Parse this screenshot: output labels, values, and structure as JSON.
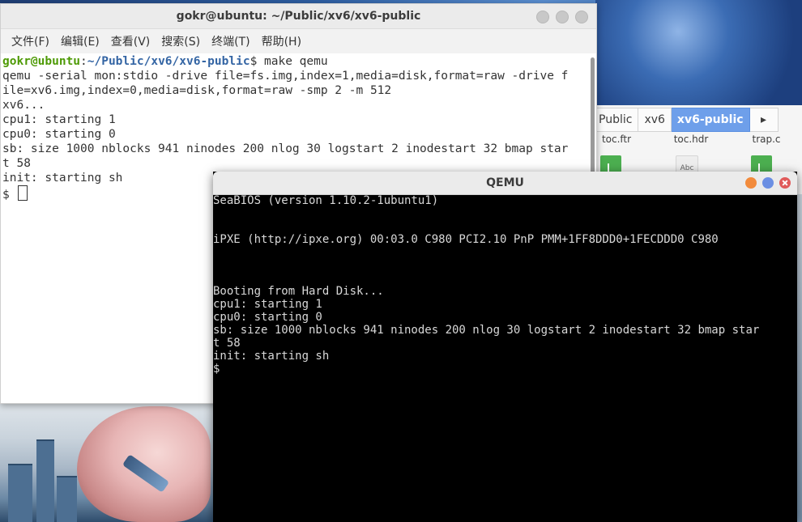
{
  "terminal": {
    "title": "gokr@ubuntu: ~/Public/xv6/xv6-public",
    "menu": [
      "文件(F)",
      "编辑(E)",
      "查看(V)",
      "搜索(S)",
      "终端(T)",
      "帮助(H)"
    ],
    "prompt_user": "gokr@ubuntu",
    "prompt_sep": ":",
    "prompt_path": "~/Public/xv6/xv6-public",
    "prompt_cmd": "$ make qemu",
    "lines": [
      "qemu -serial mon:stdio -drive file=fs.img,index=1,media=disk,format=raw -drive f",
      "ile=xv6.img,index=0,media=disk,format=raw -smp 2 -m 512",
      "xv6...",
      "cpu1: starting 1",
      "cpu0: starting 0",
      "sb: size 1000 nblocks 941 ninodes 200 nlog 30 logstart 2 inodestart 32 bmap star",
      "t 58",
      "init: starting sh"
    ],
    "final_prompt": "$ "
  },
  "file_manager": {
    "breadcrumbs": [
      "Public",
      "xv6",
      "xv6-public"
    ],
    "active_crumb": "xv6-public",
    "files": [
      "toc.ftr",
      "toc.hdr",
      "trap.c"
    ],
    "file_icon_labels": [
      "",
      "Abc",
      ""
    ]
  },
  "qemu": {
    "title": "QEMU",
    "lines": [
      "SeaBIOS (version 1.10.2-1ubuntu1)",
      "",
      "",
      "iPXE (http://ipxe.org) 00:03.0 C980 PCI2.10 PnP PMM+1FF8DDD0+1FECDDD0 C980",
      "",
      "",
      "",
      "Booting from Hard Disk...",
      "cpu1: starting 1",
      "cpu0: starting 0",
      "sb: size 1000 nblocks 941 ninodes 200 nlog 30 logstart 2 inodestart 32 bmap star",
      "t 58",
      "init: starting sh",
      "$"
    ]
  },
  "colors": {
    "prompt_user": "#4e9a06",
    "prompt_path": "#3465a4",
    "crumb_active": "#6e9fea",
    "qemu_min": "#f28b3c",
    "qemu_max": "#6b8fe3",
    "qemu_close": "#e05a5a"
  }
}
